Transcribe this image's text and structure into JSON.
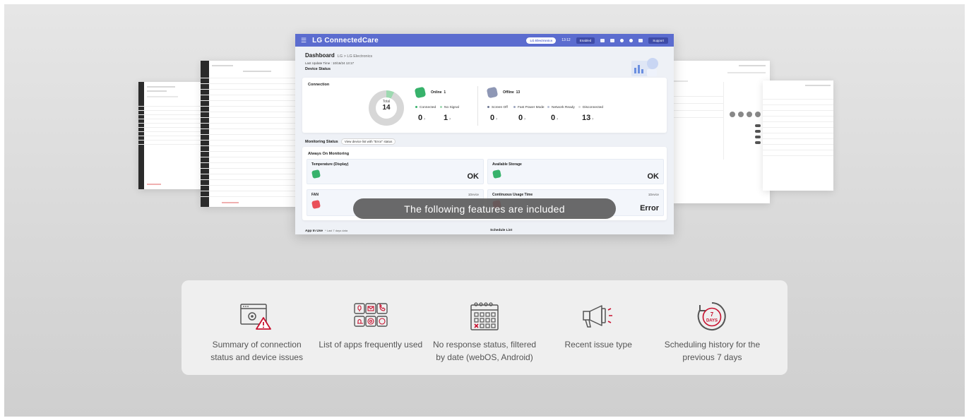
{
  "dashboard": {
    "app_title": "LG ConnectedCare",
    "topbar": {
      "org_pill": "LG Electronics",
      "time": "13:12",
      "status_pill": "Enabled",
      "support_label": "Support"
    },
    "title": "Dashboard",
    "breadcrumb": "LG > LG Electronics",
    "last_update": "Last Update Time : 10/16/24 13:17",
    "device_status_label": "Device Status",
    "connection": {
      "title": "Connection",
      "total_label": "Total",
      "total_value": "14",
      "online_label": "Online",
      "online_value": "1",
      "offline_label": "Offline",
      "offline_value": "13",
      "legend": [
        {
          "label": "Connected",
          "value": "0",
          "color": "#37b26b"
        },
        {
          "label": "No Signal",
          "value": "1",
          "color": "#9dd9b0"
        },
        {
          "label": "Screen Off",
          "value": "0",
          "color": "#6f7893"
        },
        {
          "label": "Fast Power Mode",
          "value": "0",
          "color": "#9aa3bd"
        },
        {
          "label": "Network Ready",
          "value": "0",
          "color": "#b8bfd2"
        },
        {
          "label": "Disconnected",
          "value": "13",
          "color": "#d7d7d7"
        }
      ]
    },
    "monitoring": {
      "title": "Monitoring Status",
      "filter_button": "View device list with \"Error\" status",
      "always_on": "Always On Monitoring",
      "items": [
        {
          "title": "Temperature (Display)",
          "value": "OK"
        },
        {
          "title": "Available Storage",
          "value": "OK"
        },
        {
          "title": "FAN",
          "value": "",
          "link": "1Device"
        },
        {
          "title": "Continuous Usage Time",
          "value": "Error",
          "link": "1Device"
        }
      ]
    },
    "app_in_use": "App In Use",
    "app_in_use_sub": "* Last 7 days data",
    "schedule_list": "Schedule List",
    "banner": "The following features are included"
  },
  "features": [
    {
      "icon": "connection-warning-icon",
      "text": "Summary of connection status and device issues"
    },
    {
      "icon": "app-grid-icon",
      "text": "List of apps frequently used"
    },
    {
      "icon": "calendar-x-icon",
      "text": "No response status, filtered by date (webOS, Android)"
    },
    {
      "icon": "megaphone-icon",
      "text": "Recent issue type"
    },
    {
      "icon": "seven-days-icon",
      "text": "Scheduling history for the previous 7 days",
      "badge": "7",
      "badge_sub": "DAYS"
    }
  ],
  "colors": {
    "topbar": "#5b6ccf",
    "online": "#37b26b",
    "error": "#e9505a",
    "accent_red": "#c8102e",
    "icon_stroke": "#555555"
  }
}
